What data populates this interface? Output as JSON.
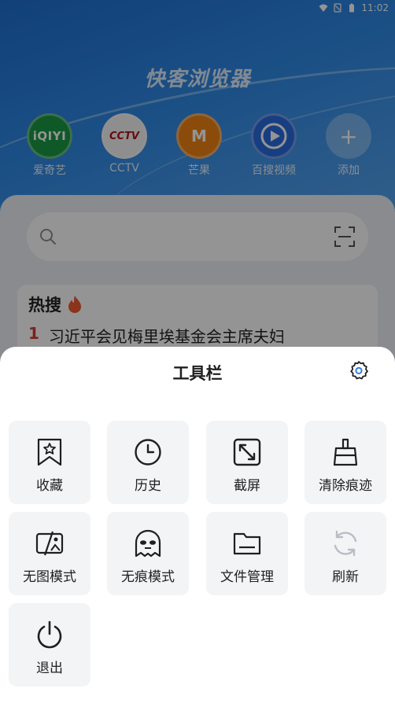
{
  "status_bar": {
    "time": "11:02"
  },
  "app_title": "快客浏览器",
  "quick_links": [
    {
      "label": "爱奇艺",
      "logo": "iQIYI",
      "icon": "iqiyi-logo"
    },
    {
      "label": "CCTV",
      "logo": "CCTV",
      "icon": "cctv-logo"
    },
    {
      "label": "芒果",
      "logo": "M",
      "icon": "mango-logo"
    },
    {
      "label": "百搜视频",
      "logo": "",
      "icon": "baidu-video-logo"
    },
    {
      "label": "添加",
      "logo": "+",
      "icon": "plus-icon"
    }
  ],
  "hot_search": {
    "title": "热搜",
    "items": [
      {
        "rank": "1",
        "text": "习近平会见梅里埃基金会主席夫妇"
      }
    ]
  },
  "toolbar": {
    "title": "工具栏",
    "items": [
      {
        "label": "收藏",
        "icon": "bookmark-star-icon"
      },
      {
        "label": "历史",
        "icon": "clock-icon"
      },
      {
        "label": "截屏",
        "icon": "screenshot-icon"
      },
      {
        "label": "清除痕迹",
        "icon": "broom-icon"
      },
      {
        "label": "无图模式",
        "icon": "no-image-icon"
      },
      {
        "label": "无痕模式",
        "icon": "incognito-ghost-icon"
      },
      {
        "label": "文件管理",
        "icon": "folder-icon"
      },
      {
        "label": "刷新",
        "icon": "refresh-icon"
      },
      {
        "label": "退出",
        "icon": "power-icon"
      }
    ]
  },
  "colors": {
    "accent": "#1e6fd0",
    "sheet_bg": "#ffffff",
    "tile_bg": "#f3f4f6",
    "hot_rank": "#d83a2e",
    "refresh_icon_disabled": "#b9bdc4"
  }
}
